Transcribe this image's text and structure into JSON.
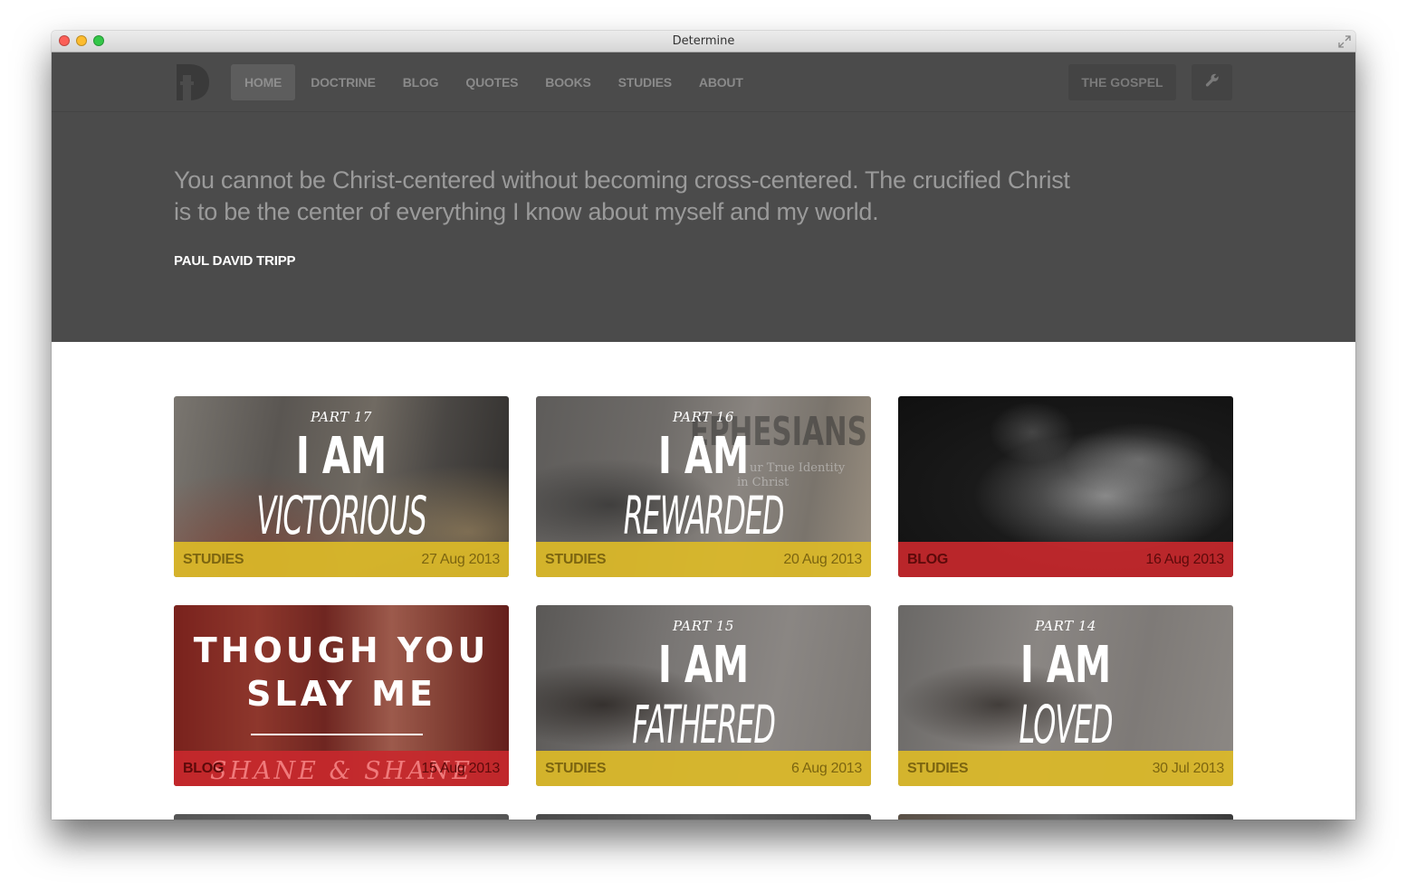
{
  "window": {
    "title": "Determine"
  },
  "nav": {
    "logo_icon": "determine-d-logo",
    "items": [
      "HOME",
      "DOCTRINE",
      "BLOG",
      "QUOTES",
      "BOOKS",
      "STUDIES",
      "ABOUT"
    ],
    "active": "HOME",
    "gospel_label": "THE GOSPEL",
    "settings_icon": "wrench-icon"
  },
  "hero": {
    "quote": "You cannot be Christ-centered without becoming cross-centered. The crucified Christ is to be the center of everything I know about myself and my world.",
    "author": "PAUL DAVID TRIPP"
  },
  "colors": {
    "nav_bg": "#4b4b4b",
    "studies": "#dcb928",
    "blog": "#c8282c"
  },
  "cards": [
    {
      "category": "STUDIES",
      "date": "27 Aug 2013",
      "part": "PART 17",
      "title_top": "I AM",
      "title_bottom": "VICTORIOUS"
    },
    {
      "category": "STUDIES",
      "date": "20 Aug 2013",
      "part": "PART 16",
      "title_top": "I AM",
      "title_bottom": "REWARDED",
      "bg_title": "EPHESIANS",
      "bg_sub1": "ur True Identity",
      "bg_sub2": "in Christ"
    },
    {
      "category": "BLOG",
      "date": "16 Aug 2013"
    },
    {
      "category": "BLOG",
      "date": "15 Aug 2013",
      "title_line1": "THOUGH YOU",
      "title_line2": "SLAY ME",
      "subtitle": "SHANE & SHANE"
    },
    {
      "category": "STUDIES",
      "date": "6 Aug 2013",
      "part": "PART 15",
      "title_top": "I AM",
      "title_bottom": "FATHERED"
    },
    {
      "category": "STUDIES",
      "date": "30 Jul 2013",
      "part": "PART 14",
      "title_top": "I AM",
      "title_bottom": "LOVED"
    }
  ]
}
